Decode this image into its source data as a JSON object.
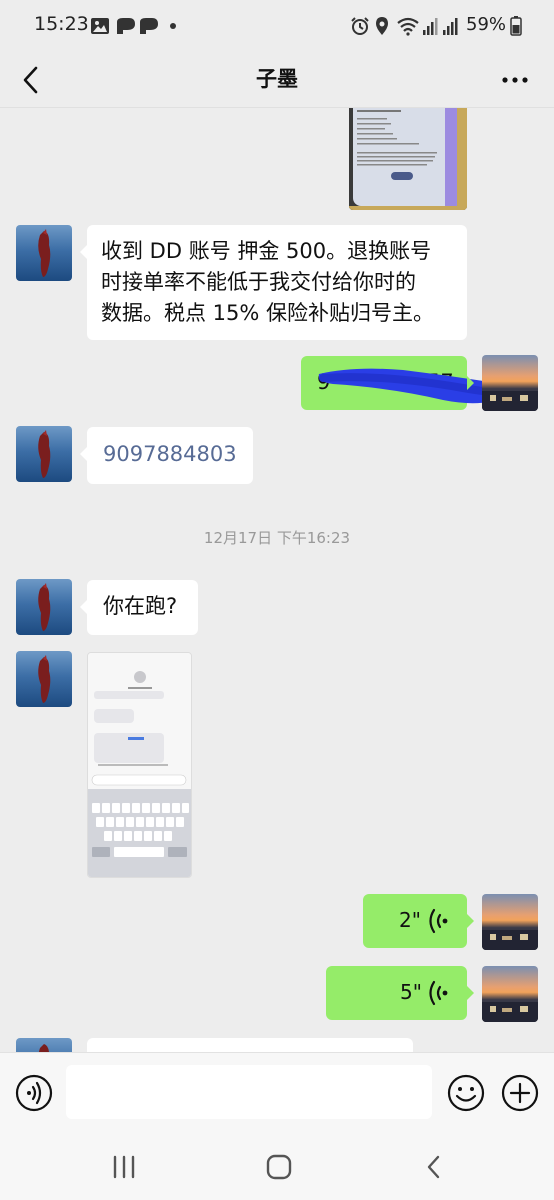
{
  "status_bar": {
    "time": "15:23",
    "battery": "59%",
    "icons": [
      "gallery-icon",
      "p-app-icon",
      "p-app-icon",
      "dot-icon",
      "alarm-icon",
      "location-icon",
      "wifi-icon",
      "signal-icon",
      "signal-icon",
      "battery-icon"
    ]
  },
  "header": {
    "title": "子墨",
    "back_icon": "chevron-left-icon",
    "more_icon": "more-dots-icon"
  },
  "messages": [
    {
      "side": "right",
      "type": "image",
      "desc": "phone-screenshot"
    },
    {
      "side": "left",
      "type": "text",
      "lines": [
        "收到 DD 账号 押金 500。退换账号",
        "时接单率不能低于我交付给你时的",
        "数据。税点 15% 保险补贴归号主。"
      ]
    },
    {
      "side": "right",
      "type": "text",
      "text": "9",
      "text_tail": "57",
      "redacted": true
    },
    {
      "side": "left",
      "type": "text",
      "text": "9097884803"
    },
    {
      "type": "timestamp",
      "text": "12月17日 下午16:23"
    },
    {
      "side": "left",
      "type": "text",
      "text": "你在跑?"
    },
    {
      "side": "left",
      "type": "image",
      "desc": "messages-screenshot"
    },
    {
      "side": "right",
      "type": "voice",
      "duration": "2\""
    },
    {
      "side": "right",
      "type": "voice",
      "duration": "5\""
    },
    {
      "side": "left",
      "type": "text",
      "text": ""
    }
  ],
  "input_bar": {
    "voice_icon": "voice-toggle-icon",
    "emoji_icon": "emoji-icon",
    "plus_icon": "plus-icon"
  },
  "nav_bar": {
    "icons": [
      "recent-apps-icon",
      "home-icon",
      "back-icon"
    ]
  },
  "colors": {
    "bg": "#ededed",
    "bubble_right": "#95ec69",
    "bubble_left": "#ffffff",
    "redaction": "#2a3ee6"
  }
}
